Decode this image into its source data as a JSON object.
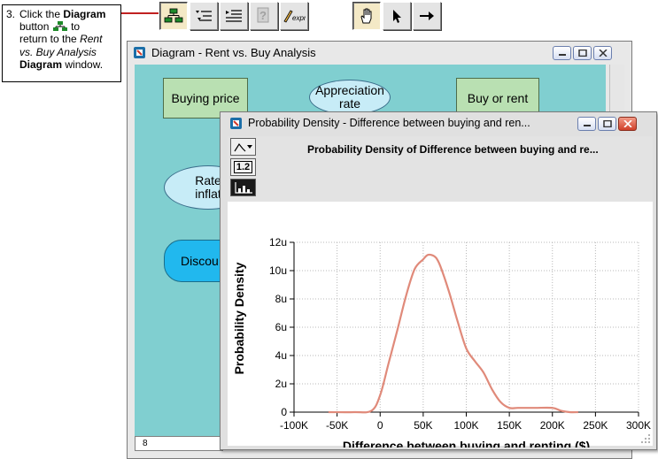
{
  "callout": {
    "step": "3.",
    "pre": "Click the",
    "diagram_bold": "Diagram",
    "button_word": "button",
    "to_word": "to",
    "return_to": "return to the",
    "rent_italic": "Rent",
    "vs_italic": "vs. Buy Analysis",
    "diagram_window_bold": "Diagram",
    "window_word": "window."
  },
  "toolbar": {
    "buttons": [
      {
        "icon": "diagram-icon",
        "active": true
      },
      {
        "icon": "outline-icon"
      },
      {
        "icon": "list-icon"
      },
      {
        "icon": "help-icon",
        "disabled": true
      },
      {
        "icon": "expression-icon"
      }
    ],
    "tools": [
      {
        "icon": "hand-tool-icon",
        "active": true
      },
      {
        "icon": "arrow-pointer-icon"
      },
      {
        "icon": "draw-arrow-icon"
      }
    ]
  },
  "diagram_window": {
    "title": "Diagram - Rent vs. Buy Analysis",
    "nodes": {
      "buying_price": "Buying price",
      "appreciation_line1": "Appreciation",
      "appreciation_line2": "rate",
      "buy_or_rent": "Buy or rent",
      "rate_inflation_line1": "Rate",
      "rate_inflation_line2": "inflat",
      "discount": "Discou"
    },
    "status_glyph": "8"
  },
  "prob_window": {
    "title": "Probability Density - Difference between buying and ren...",
    "heading": "Probability Density of Difference between buying and re...",
    "sidebar": {
      "chart_type_icon": "chart-type-icon",
      "number_format_label": "1.2",
      "graph_view_icon": "graph-view-icon"
    }
  },
  "chart_data": {
    "type": "line",
    "xlabel": "Difference between buying and renting ($)",
    "ylabel": "Probability Density",
    "x_tick_labels": [
      "-100K",
      "-50K",
      "0",
      "50K",
      "100K",
      "150K",
      "200K",
      "250K",
      "300K"
    ],
    "y_tick_labels": [
      "0",
      "2u",
      "4u",
      "6u",
      "8u",
      "10u",
      "12u"
    ],
    "xlim": [
      -100000,
      300000
    ],
    "ylim": [
      0,
      1.2e-05
    ],
    "grid": true,
    "line_color": "#e08a7a",
    "series": [
      {
        "x": [
          -60000,
          -30000,
          -10000,
          0,
          10000,
          20000,
          30000,
          40000,
          50000,
          55000,
          60000,
          65000,
          70000,
          80000,
          90000,
          100000,
          110000,
          120000,
          130000,
          140000,
          150000,
          160000,
          180000,
          200000,
          210000,
          220000,
          230000
        ],
        "y": [
          0,
          0,
          1e-07,
          1.2e-06,
          3.5e-06,
          5.8e-06,
          8.2e-06,
          1.01e-05,
          1.08e-05,
          1.11e-05,
          1.11e-05,
          1.09e-05,
          1.03e-05,
          8.5e-06,
          6.4e-06,
          4.5e-06,
          3.6e-06,
          2.8e-06,
          1.6e-06,
          7e-07,
          3e-07,
          3e-07,
          3e-07,
          3e-07,
          1e-07,
          0,
          0
        ]
      }
    ]
  }
}
